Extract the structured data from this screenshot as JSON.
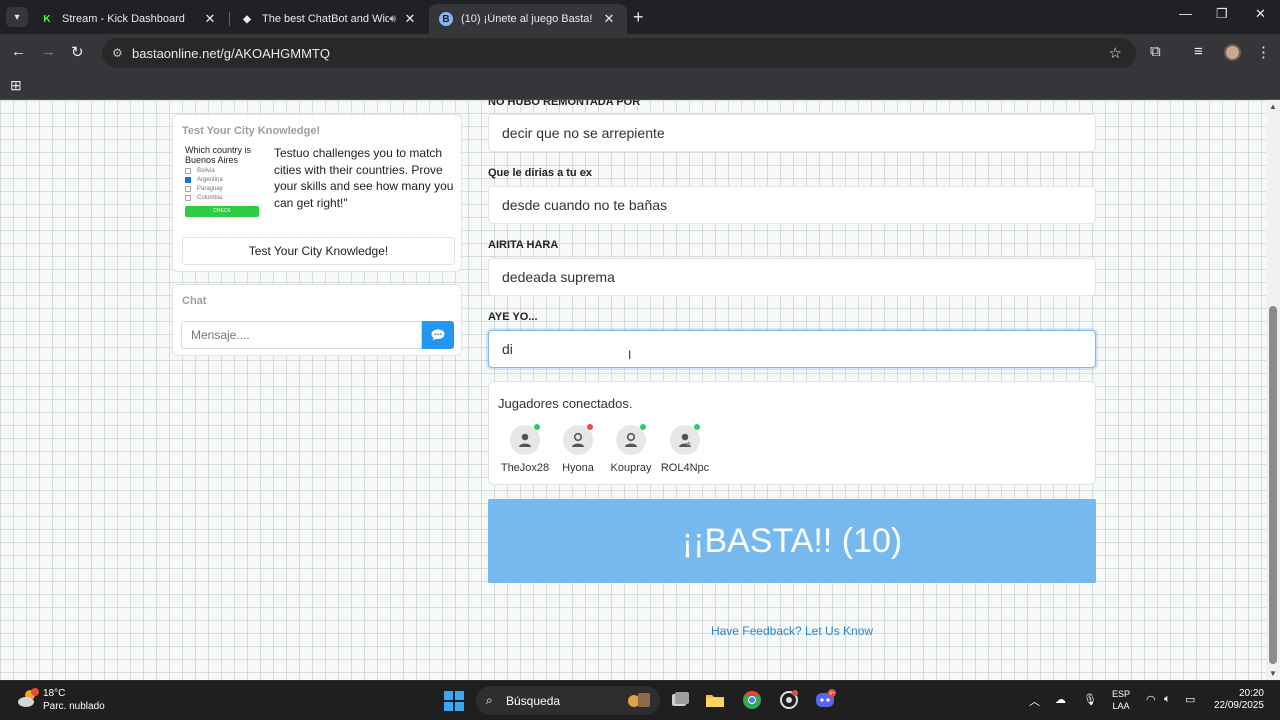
{
  "browser": {
    "tabs": [
      {
        "title": "Stream - Kick Dashboard",
        "favicon": "K",
        "active": false
      },
      {
        "title": "The best ChatBot and Widg",
        "favicon": "◆",
        "active": false
      },
      {
        "title": "(10) ¡Únete al juego Basta!",
        "favicon": "B",
        "active": true
      }
    ],
    "url": "bastaonline.net/g/AKOAHGMMTQ"
  },
  "sidebar": {
    "ad": {
      "heading": "Test Your City Knowledge!",
      "quiz_question": "Which country is Buenos Aires",
      "quiz_options": [
        "Bolivia",
        "Argentina",
        "Paraguay",
        "Colombia"
      ],
      "quiz_check": "CHECK",
      "text": "Testuo challenges you to match cities with their countries. Prove your skills and see how many you can get right!\"",
      "button": "Test Your City Knowledge!"
    },
    "chat": {
      "heading": "Chat",
      "placeholder": "Mensaje...."
    }
  },
  "form": {
    "fields": [
      {
        "label": "NO HUBO REMONTADA POR",
        "value": "decir que no se arrepiente"
      },
      {
        "label": "Que le dirias a tu ex",
        "value": "desde cuando no te bañas"
      },
      {
        "label": "AIRITA HARA",
        "value": "dedeada suprema"
      },
      {
        "label": "AYE YO...",
        "value": "di"
      }
    ]
  },
  "players": {
    "title": "Jugadores conectados.",
    "list": [
      {
        "name": "TheJox28",
        "status": "online"
      },
      {
        "name": "Hyona",
        "status": "away"
      },
      {
        "name": "Koupray",
        "status": "online"
      },
      {
        "name": "ROL4Npc",
        "status": "online"
      }
    ]
  },
  "basta_button": "¡¡BASTA!! (10)",
  "feedback_link": "Have Feedback? Let Us Know",
  "taskbar": {
    "weather_temp": "18°C",
    "weather_desc": "Parc. nublado",
    "search_label": "Búsqueda",
    "lang_1": "ESP",
    "lang_2": "LAA",
    "time": "20:20",
    "date": "22/09/2025",
    "discord_badge": "9+"
  },
  "colors": {
    "basta_button": "#76b9ef",
    "chat_send": "#2196f3",
    "link": "#2b87c7",
    "status_online": "#2ecc71",
    "status_away": "#e74c3c"
  }
}
